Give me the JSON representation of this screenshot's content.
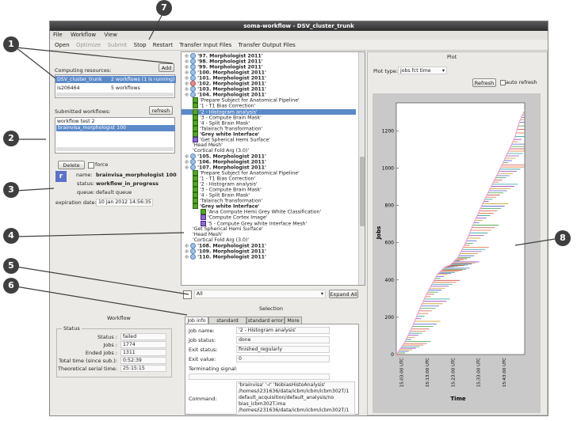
{
  "window": {
    "title": "soma-workflow - DSV_cluster_trunk"
  },
  "menu": [
    "File",
    "Workflow",
    "View"
  ],
  "toolbar": {
    "open": "Open",
    "optimize": "Optimize",
    "submit": "Submit",
    "stop": "Stop",
    "restart": "Restart",
    "transfer_input": "Transfer Input Files",
    "transfer_output": "Transfer Output Files"
  },
  "left": {
    "computing_label": "Computing resources:",
    "add": "Add",
    "resource_name": "DSV_cluster_trunk",
    "resource_status": "2 workflows (1 is running)",
    "resource2_name": "is206464",
    "resource2_status": "5 workflows",
    "submitted_label": "Submitted workflows:",
    "refresh": "refresh",
    "workflows": [
      "workflow test 2",
      "brainvisa_morphologist 100"
    ],
    "delete": "Delete",
    "force": "force",
    "name_key": "name:",
    "name_val": "brainvisa_morphologist 100",
    "status_key": "status:",
    "status_val": "workflow_in_progress",
    "queue_key": "queue:",
    "queue_val": "default queue",
    "expiration_key": "expiration date:",
    "expiration_val": "10 Jan 2012 14:56:35"
  },
  "tree": [
    {
      "text": "'97. Morphologist 2011'",
      "icon": "dot",
      "indent": 0,
      "bold": true
    },
    {
      "text": "'98. Morphologist 2011'",
      "icon": "dot",
      "indent": 0,
      "bold": true
    },
    {
      "text": "'99. Morphologist 2011'",
      "icon": "dot",
      "indent": 0,
      "bold": true
    },
    {
      "text": "'100. Morphologist 2011'",
      "icon": "dot",
      "indent": 0,
      "bold": true
    },
    {
      "text": "'101. Morphologist 2011'",
      "icon": "dot",
      "indent": 0,
      "bold": true
    },
    {
      "text": "'102. Morphologist 2011'",
      "icon": "red",
      "indent": 0,
      "bold": true
    },
    {
      "text": "'103. Morphologist 2011'",
      "icon": "dot",
      "indent": 0,
      "bold": true
    },
    {
      "text": "'104. Morphologist 2011'",
      "icon": "dot",
      "indent": 0,
      "bold": true
    },
    {
      "text": "'Prepare Subject for Anatomical Pipeline'",
      "icon": "green",
      "indent": 1,
      "bold": false
    },
    {
      "text": "'1 - T1 Bias Correction'",
      "icon": "green",
      "indent": 1,
      "bold": false
    },
    {
      "text": "'2 - Histogram analysis'",
      "icon": "green",
      "indent": 1,
      "bold": false,
      "selected": true
    },
    {
      "text": "'3 - Compute Brain Mask'",
      "icon": "green",
      "indent": 1,
      "bold": false
    },
    {
      "text": "'4 - Split Brain Mask'",
      "icon": "green",
      "indent": 1,
      "bold": false
    },
    {
      "text": "'Talairach Transformation'",
      "icon": "green",
      "indent": 1,
      "bold": false
    },
    {
      "text": "'Grey white Interface'",
      "icon": "green",
      "indent": 1,
      "bold": true
    },
    {
      "text": "'Get Spherical Hemi Surface'",
      "icon": "purple",
      "indent": 1,
      "bold": false
    },
    {
      "text": "'Head Mesh'",
      "icon": "none",
      "indent": 1,
      "bold": false
    },
    {
      "text": "'Cortical Fold Arg (3.0)'",
      "icon": "none",
      "indent": 1,
      "bold": false
    },
    {
      "text": "'105. Morphologist 2011'",
      "icon": "dot",
      "indent": 0,
      "bold": true
    },
    {
      "text": "'106. Morphologist 2011'",
      "icon": "dot",
      "indent": 0,
      "bold": true
    },
    {
      "text": "'107. Morphologist 2011'",
      "icon": "dot",
      "indent": 0,
      "bold": true
    },
    {
      "text": "'Prepare Subject for Anatomical Pipeline'",
      "icon": "green",
      "indent": 1,
      "bold": false
    },
    {
      "text": "'1 - T1 Bias Correction'",
      "icon": "green",
      "indent": 1,
      "bold": false
    },
    {
      "text": "'2 - Histogram analysis'",
      "icon": "green",
      "indent": 1,
      "bold": false
    },
    {
      "text": "'3 - Compute Brain Mask'",
      "icon": "green",
      "indent": 1,
      "bold": false
    },
    {
      "text": "'4 - Split Brain Mask'",
      "icon": "green",
      "indent": 1,
      "bold": false
    },
    {
      "text": "'Talairach Transformation'",
      "icon": "green",
      "indent": 1,
      "bold": false
    },
    {
      "text": "'Grey white Interface'",
      "icon": "green",
      "indent": 1,
      "bold": true
    },
    {
      "text": "'Ana Compute Hemi Grey White Classification'",
      "icon": "green",
      "indent": 2,
      "bold": false
    },
    {
      "text": "'Compute Cortex Image'",
      "icon": "purple",
      "indent": 2,
      "bold": false
    },
    {
      "text": "'5 - Compute Grey white Interface Mesh'",
      "icon": "purple",
      "indent": 2,
      "bold": false
    },
    {
      "text": "'Get Spherical Hemi Surface'",
      "icon": "none",
      "indent": 1,
      "bold": false
    },
    {
      "text": "'Head Mesh'",
      "icon": "none",
      "indent": 1,
      "bold": false
    },
    {
      "text": "'Cortical Fold Arg (3.0)'",
      "icon": "none",
      "indent": 1,
      "bold": false
    },
    {
      "text": "'108. Morphologist 2011'",
      "icon": "dot",
      "indent": 0,
      "bold": true
    },
    {
      "text": "'109. Morphologist 2011'",
      "icon": "dot",
      "indent": 0,
      "bold": true
    },
    {
      "text": "'110. Morphologist 2011'",
      "icon": "dot",
      "indent": 0,
      "bold": true
    }
  ],
  "filter": {
    "value": "All",
    "expand": "Expand All"
  },
  "workflow_panel": {
    "title": "Workflow",
    "status_group": "Status",
    "rows": [
      {
        "key": "Status :",
        "val": "failed"
      },
      {
        "key": "Jobs :",
        "val": "1774"
      },
      {
        "key": "Ended jobs :",
        "val": "1311"
      },
      {
        "key": "Total time (since sub.):",
        "val": "0:52:39"
      },
      {
        "key": "Theoretical serial time:",
        "val": "25:15:15"
      }
    ]
  },
  "selection": {
    "title": "Selection",
    "tabs": [
      "Job info",
      "standard output",
      "standard error",
      "More"
    ],
    "job_name_key": "Job name:",
    "job_name_val": "'2 - Histogram analysis'",
    "job_status_key": "Job status:",
    "job_status_val": "done",
    "exit_status_key": "Exit status:",
    "exit_status_val": "finished_regularly",
    "exit_value_key": "Exit value:",
    "exit_value_val": "0",
    "term_key": "Terminating signal:",
    "term_val": "",
    "command_key": "Command:",
    "command_lines": [
      "'brainvisa' '-r' 'NobiasHistoAnalysis'",
      "/homes/i231636/data/icbm/icbm/icbm302T/1",
      "default_acquisition/default_analysis/no",
      "bias_icbm302T.ima",
      "/homes/i231636/data/icbm/icbm/icbm302T/1"
    ]
  },
  "plot": {
    "title": "Plot",
    "type_label": "Plot type:",
    "type_value": "jobs fct time",
    "refresh": "Refresh",
    "auto_refresh": "auto refresh"
  },
  "chart_data": {
    "type": "line",
    "xlabel": "Time",
    "ylabel": "Jobs",
    "yticks": [
      0,
      200,
      400,
      600,
      800,
      1000,
      1200
    ],
    "xticks": [
      "15:03:00 UTC",
      "15:13:00 UTC",
      "15:23:00 UTC",
      "15:33:00 UTC",
      "15:43:00 UTC"
    ],
    "ylim": [
      0,
      1350
    ],
    "xlim_minutes": [
      0,
      50
    ],
    "series": [
      {
        "x": [
          0,
          3,
          6,
          9,
          12,
          16,
          19,
          21,
          24,
          27,
          30,
          34,
          38,
          42,
          46,
          48,
          50
        ],
        "values": [
          0,
          60,
          140,
          240,
          330,
          430,
          470,
          480,
          520,
          600,
          700,
          820,
          930,
          1040,
          1160,
          1250,
          1310
        ]
      }
    ]
  },
  "callouts": [
    "1",
    "2",
    "3",
    "4",
    "5",
    "6",
    "7",
    "8"
  ],
  "colors": {
    "selected": "#5c8ac8",
    "callout": "#3f3f3f",
    "chart_line": "#f0a0d0"
  }
}
